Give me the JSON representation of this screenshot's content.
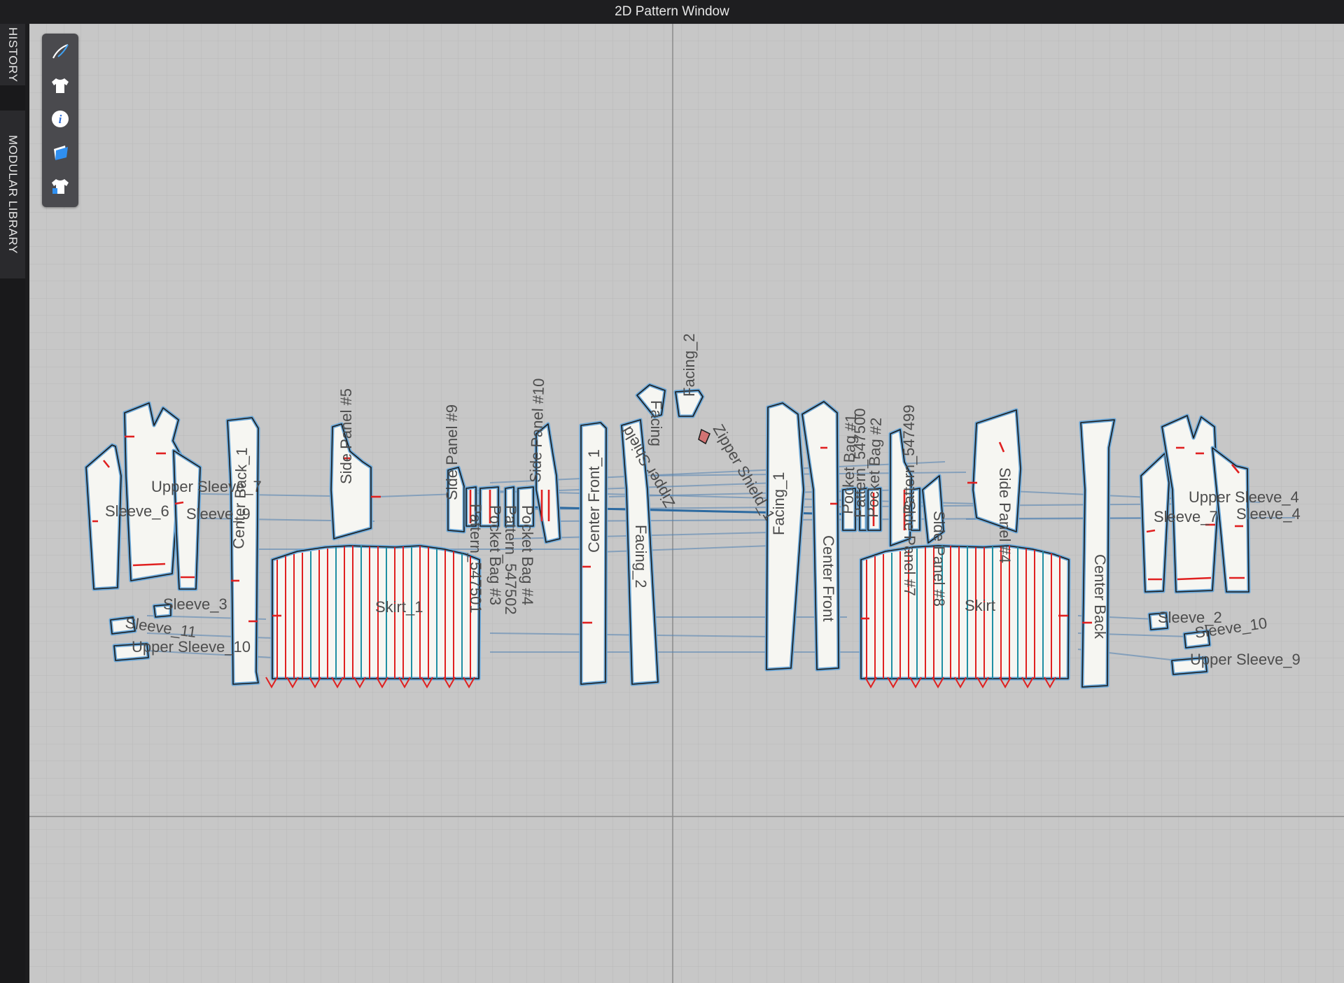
{
  "window": {
    "title": "2D Pattern Window"
  },
  "side_tabs": {
    "history": "HISTORY",
    "modular_library": "MODULAR LIBRARY"
  },
  "toolbar": {
    "tools": [
      "pen-icon",
      "garment-icon",
      "info-icon",
      "layers-icon",
      "avatar-garment-icon"
    ]
  },
  "colors": {
    "canvas": "#c7c7c7",
    "piece_fill": "#f6f6f2",
    "piece_outline": "#6aa7d8",
    "seam_line": "#4f80b0",
    "pleat_red": "#e02020",
    "pleat_teal": "#1f8fa3"
  },
  "pattern_labels": {
    "upper_sleeve_7": "Upper Sleeve_7",
    "sleeve_6": "Sleeve_6",
    "sleeve_9": "Sleeve_9",
    "center_back_1": "Center Back_1",
    "side_panel_5": "Side Panel #5",
    "side_panel_9": "Side Panel #9",
    "side_panel_10": "Side Panel #10",
    "facing_2": "Facing_2",
    "facing": "Facing",
    "zipper_shield_1": "Zipper Shield_1",
    "zipper_shield": "Zipper Shield",
    "center_front_1": "Center Front_1",
    "facing_1": "Facing_1",
    "facing_2b": "Facing_2",
    "center_front": "Center Front",
    "pocket_bag_1": "Pocket Bag #1",
    "pocket_bag_2": "Pocket Bag #2",
    "pattern_547500": "Pattern_547500",
    "pattern_547499": "Pattern_547499",
    "side_panel_4": "Side Panel #4",
    "side_panel_7": "Side Panel #7",
    "side_panel_8": "Side Panel #8",
    "skirt_1": "Skirt_1",
    "skirt": "Skirt",
    "pattern_547501": "Pattern_547501",
    "pocket_bag_3": "Pocket Bag #3",
    "pattern_547502": "Pattern_547502",
    "pocket_bag_4": "Pocket Bag #4",
    "sleeve_3": "Sleeve_3",
    "sleeve_11": "Sleeve_11",
    "upper_sleeve_10": "Upper Sleeve_10",
    "center_back": "Center Back",
    "upper_sleeve_4": "Upper Sleeve_4",
    "sleeve_7": "Sleeve_7",
    "sleeve_4": "Sleeve_4",
    "sleeve_2": "Sleeve_2",
    "sleeve_10": "Sleeve_10",
    "upper_sleeve_9": "Upper Sleeve_9"
  }
}
